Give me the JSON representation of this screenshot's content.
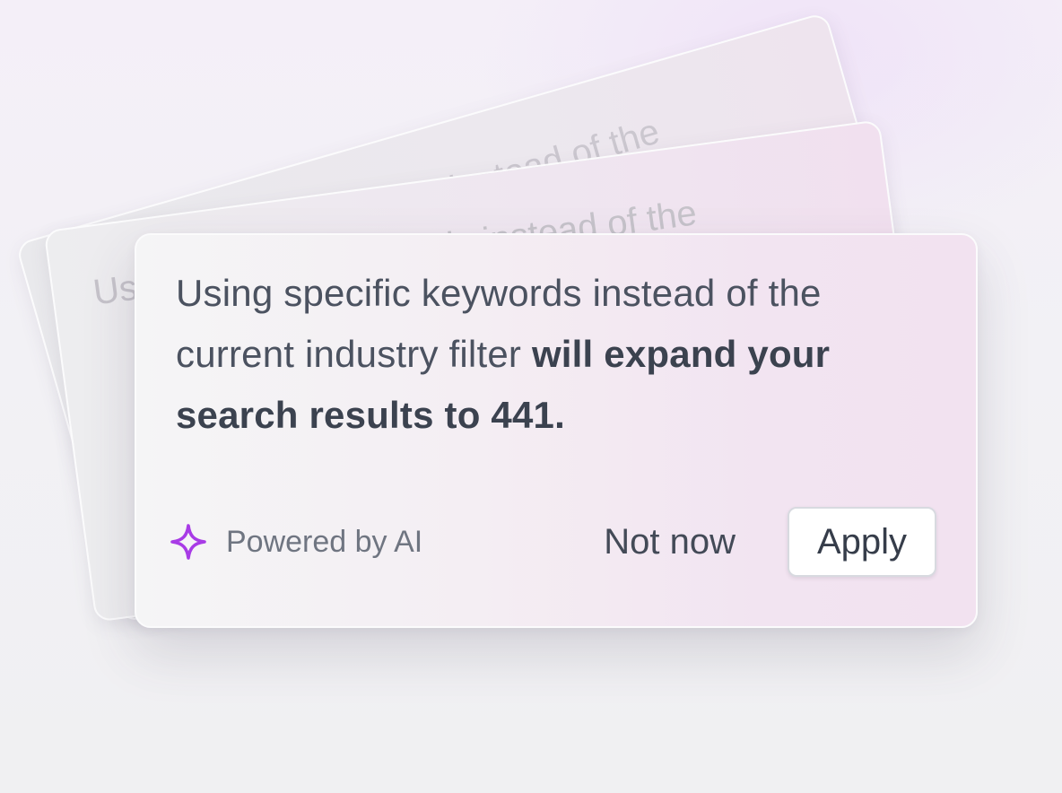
{
  "suggestion": {
    "text_regular": "Using specific keywords instead of the current industry filter ",
    "text_emphasis": "will expand your search results to 441.",
    "stacked_card_preview": "Using specific keywords instead of the"
  },
  "footer": {
    "badge_label": "Powered by AI",
    "badge_icon": "sparkle-icon",
    "dismiss_label": "Not now",
    "apply_label": "Apply"
  },
  "colors": {
    "accent": "#a83be6",
    "text_primary": "#3b424f",
    "text_secondary": "#6f7581"
  }
}
